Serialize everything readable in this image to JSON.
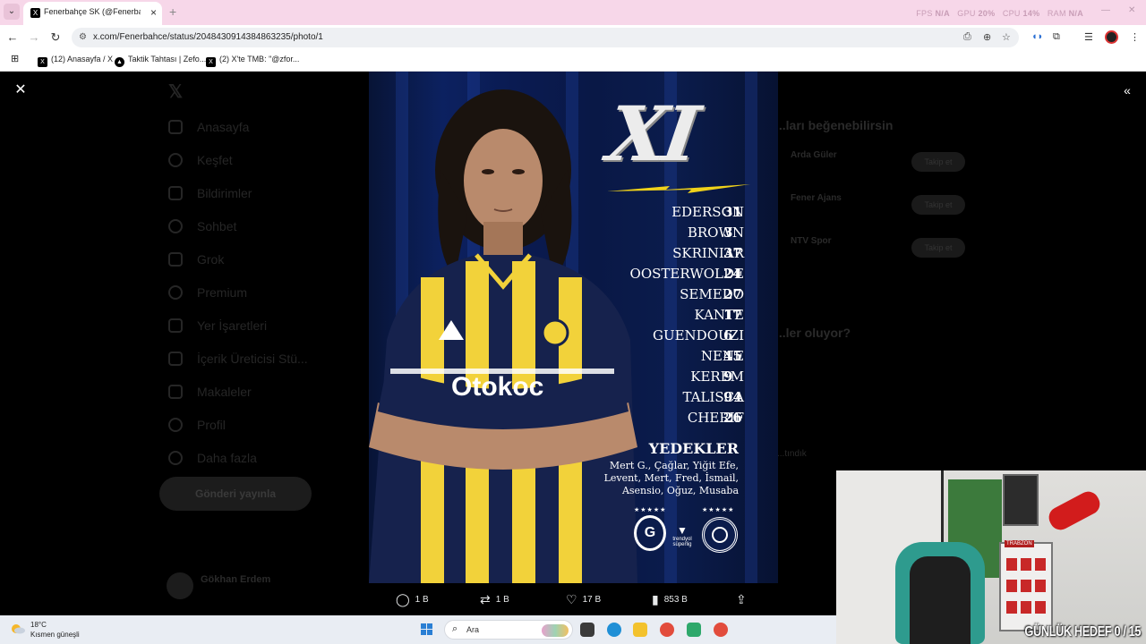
{
  "browser": {
    "tab_title": "Fenerbahçe SK (@Fenerbahce) /",
    "tab_close": "×",
    "new_tab": "+",
    "perf": {
      "fps_label": "FPS",
      "fps_value": "N/A",
      "gpu_label": "GPU",
      "gpu_value": "20%",
      "cpu_label": "CPU",
      "cpu_value": "14%",
      "ram_label": "RAM",
      "ram_value": "N/A"
    },
    "url": "x.com/Fenerbahce/status/2048430914384863235/photo/1",
    "bookmarks": [
      {
        "label": "(12) Anasayfa / X"
      },
      {
        "label": "Taktik Tahtası | Zefo..."
      },
      {
        "label": "(2) X'te TMB: \"@zfor..."
      }
    ]
  },
  "background_page": {
    "nav": [
      "Anasayfa",
      "Keşfet",
      "Bildirimler",
      "Sohbet",
      "Grok",
      "Premium",
      "Yer İşaretleri",
      "İçerik Üreticisi Stü...",
      "Makaleler",
      "Profil",
      "Daha fazla"
    ],
    "post_button": "Gönderi yayınla",
    "user_name": "Gökhan Erdem",
    "right_head_1": "...ları beğenebilirsin",
    "right_head_2": "...ler oluyor?",
    "follows": [
      {
        "name": "Arda Güler",
        "button": "Takip et"
      },
      {
        "name": "Fener Ajans",
        "button": "Takip et"
      },
      {
        "name": "NTV Spor",
        "button": "Takip et"
      }
    ],
    "side_text": "...tındık"
  },
  "photo": {
    "title": "XI",
    "lineup": [
      {
        "name": "EDERSON",
        "number": "31"
      },
      {
        "name": "BROWN",
        "number": "3"
      },
      {
        "name": "SKRINIAR",
        "number": "37"
      },
      {
        "name": "OOSTERWOLDE",
        "number": "24"
      },
      {
        "name": "SEMEDO",
        "number": "27"
      },
      {
        "name": "KANTE",
        "number": "17"
      },
      {
        "name": "GUENDOUZI",
        "number": "6"
      },
      {
        "name": "NENE",
        "number": "45"
      },
      {
        "name": "KEREM",
        "number": "9"
      },
      {
        "name": "TALISCA",
        "number": "94"
      },
      {
        "name": "CHERIF",
        "number": "26"
      }
    ],
    "subs_title": "YEDEKLER",
    "subs_lines": [
      "Mert G., Çağlar, Yiğit Efe,",
      "Levent, Mert, Fred, İsmail,",
      "Asensio, Oğuz, Musaba"
    ],
    "league_logo_text": "trendyol süperlig",
    "sponsor": "Otokoc"
  },
  "actions": {
    "replies": "1 B",
    "reposts": "1 B",
    "likes": "17 B",
    "views": "853 B"
  },
  "webcam": {
    "goal_text": "GÜNLÜK HEDEF 0 / 15",
    "shelf_label": "TRABZON"
  },
  "taskbar": {
    "temp": "18°C",
    "weather": "Kısmen güneşli",
    "search_placeholder": "Ara"
  },
  "colors": {
    "tab_strip": "#f7d7e9",
    "photo_blue": "#0c2160",
    "kit_yellow": "#f2d23a",
    "accent_bolt": "#f0d21a"
  }
}
